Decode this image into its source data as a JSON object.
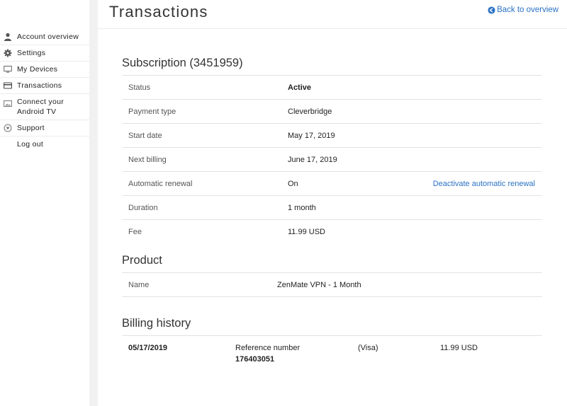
{
  "header": {
    "title": "Transactions",
    "back_link": "Back to overview"
  },
  "sidebar": {
    "items": [
      {
        "label": "Account overview",
        "icon": "user-icon"
      },
      {
        "label": "Settings",
        "icon": "gear-icon"
      },
      {
        "label": "My Devices",
        "icon": "monitor-icon"
      },
      {
        "label": "Transactions",
        "icon": "credit-card-icon"
      },
      {
        "label": "Connect your\nAndroid TV",
        "icon": "tv-icon"
      },
      {
        "label": "Support",
        "icon": "support-icon"
      },
      {
        "label": "Log out",
        "icon": ""
      }
    ]
  },
  "subscription": {
    "title": "Subscription (3451959)",
    "rows": [
      {
        "label": "Status",
        "value": "Active"
      },
      {
        "label": "Payment type",
        "value": "Cleverbridge"
      },
      {
        "label": "Start date",
        "value": "May 17, 2019"
      },
      {
        "label": "Next billing",
        "value": "June 17, 2019"
      },
      {
        "label": "Automatic renewal",
        "value": "On",
        "action": "Deactivate automatic renewal"
      },
      {
        "label": "Duration",
        "value": "1 month"
      },
      {
        "label": "Fee",
        "value": "11.99 USD"
      }
    ]
  },
  "product": {
    "title": "Product",
    "name_label": "Name",
    "name_value": "ZenMate VPN - 1 Month"
  },
  "billing": {
    "title": "Billing history",
    "entries": [
      {
        "date": "05/17/2019",
        "ref_label": "Reference number",
        "ref_number": "176403051",
        "method": "(Visa)",
        "amount": "11.99 USD"
      }
    ]
  },
  "colors": {
    "link": "#2a72c4",
    "divider": "#e2e2e2",
    "gutter": "#f1f1f1"
  }
}
